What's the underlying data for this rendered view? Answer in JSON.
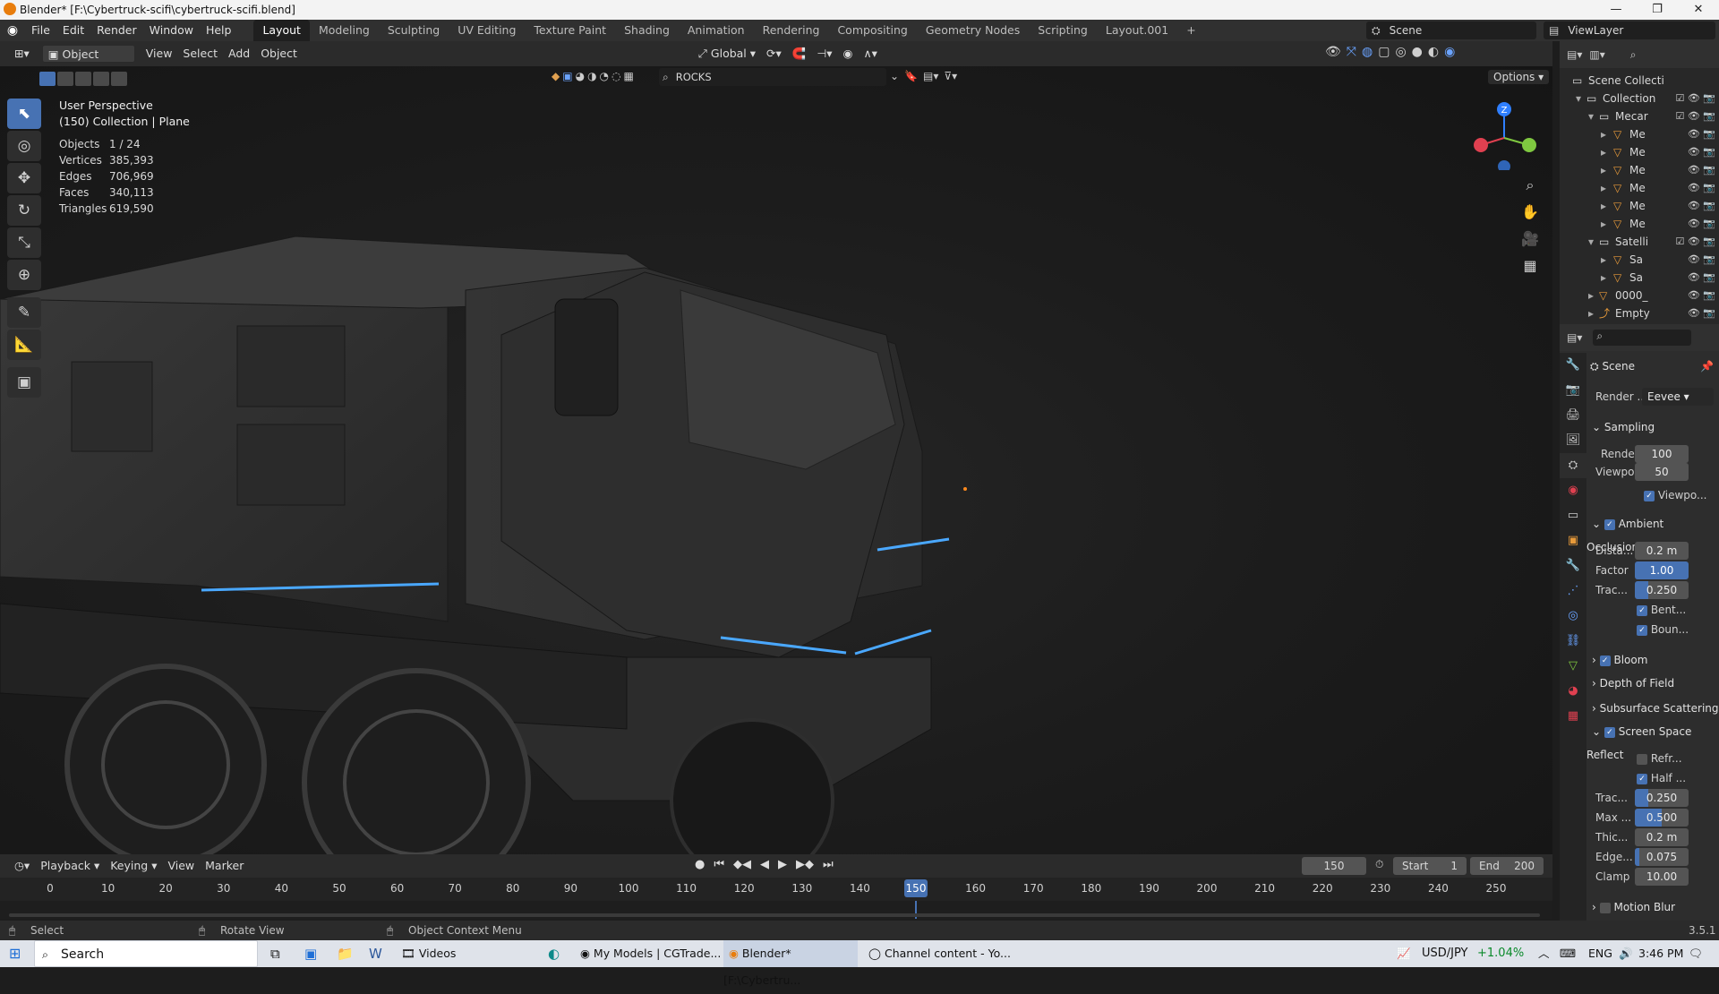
{
  "window": {
    "title": "Blender* [F:\\Cybertruck-scifi\\cybertruck-scifi.blend]",
    "buttons": [
      "—",
      "❐",
      "✕"
    ]
  },
  "menus": [
    "File",
    "Edit",
    "Render",
    "Window",
    "Help"
  ],
  "workspaces": [
    "Layout",
    "Modeling",
    "Sculpting",
    "UV Editing",
    "Texture Paint",
    "Shading",
    "Animation",
    "Rendering",
    "Compositing",
    "Geometry Nodes",
    "Scripting",
    "Layout.001",
    "+"
  ],
  "active_workspace": "Layout",
  "scene_selector": "Scene",
  "viewlayer_selector": "ViewLayer",
  "viewport_header": {
    "mode": "Object Mode",
    "menus": [
      "View",
      "Select",
      "Add",
      "Object"
    ],
    "transform_orientation": "Global",
    "search_value": "ROCKS",
    "options_label": "Options"
  },
  "viewport_overlay": {
    "view_name": "User Perspective",
    "collection_info": "(150) Collection | Plane",
    "stats": [
      {
        "label": "Objects",
        "value": "1 / 24"
      },
      {
        "label": "Vertices",
        "value": "385,393"
      },
      {
        "label": "Edges",
        "value": "706,969"
      },
      {
        "label": "Faces",
        "value": "340,113"
      },
      {
        "label": "Triangles",
        "value": "619,590"
      }
    ]
  },
  "gizmo": {
    "z_label": "Z"
  },
  "outliner": {
    "root": "Scene Collecti",
    "rows": [
      {
        "name": "Collection",
        "indent": 0,
        "icon": "collection"
      },
      {
        "name": "Mecar",
        "indent": 1,
        "icon": "collection"
      },
      {
        "name": "Me",
        "indent": 2,
        "icon": "mesh"
      },
      {
        "name": "Me",
        "indent": 2,
        "icon": "mesh"
      },
      {
        "name": "Me",
        "indent": 2,
        "icon": "mesh"
      },
      {
        "name": "Me",
        "indent": 2,
        "icon": "mesh"
      },
      {
        "name": "Me",
        "indent": 2,
        "icon": "mesh"
      },
      {
        "name": "Me",
        "indent": 2,
        "icon": "mesh"
      },
      {
        "name": "Satelli",
        "indent": 1,
        "icon": "collection"
      },
      {
        "name": "Sa",
        "indent": 2,
        "icon": "mesh"
      },
      {
        "name": "Sa",
        "indent": 2,
        "icon": "mesh"
      },
      {
        "name": "0000_",
        "indent": 1,
        "icon": "mesh"
      },
      {
        "name": "Empty",
        "indent": 1,
        "icon": "empty"
      }
    ]
  },
  "properties": {
    "context": "Scene",
    "render_engine_label": "Render ...",
    "render_engine_value": "Eevee",
    "sampling": {
      "title": "Sampling",
      "render_label": "Render",
      "render_value": "100",
      "viewport_label": "Viewport",
      "viewport_value": "50",
      "denoise_label": "Viewpo..."
    },
    "ao": {
      "title": "Ambient Occlusion",
      "distance_label": "Dista...",
      "distance_value": "0.2 m",
      "factor_label": "Factor",
      "factor_value": "1.00",
      "trace_label": "Trac...",
      "trace_value": "0.250",
      "bent_label": "Bent...",
      "bounce_label": "Boun..."
    },
    "bloom": "Bloom",
    "dof": "Depth of Field",
    "sss": "Subsurface Scattering",
    "ssr": {
      "title": "Screen Space Reflect",
      "refr_label": "Refr...",
      "half_label": "Half ...",
      "trace_label": "Trac...",
      "trace_value": "0.250",
      "max_label": "Max ...",
      "max_value": "0.500",
      "thick_label": "Thic...",
      "thick_value": "0.2 m",
      "edge_label": "Edge...",
      "edge_value": "0.075",
      "clamp_label": "Clamp",
      "clamp_value": "10.00"
    },
    "motion_blur": "Motion Blur"
  },
  "timeline": {
    "menus": [
      "Playback",
      "Keying",
      "View",
      "Marker"
    ],
    "current_frame": "150",
    "start_label": "Start",
    "start_value": "1",
    "end_label": "End",
    "end_value": "200",
    "ticks": [
      "0",
      "10",
      "20",
      "30",
      "40",
      "50",
      "60",
      "70",
      "80",
      "90",
      "100",
      "110",
      "120",
      "130",
      "140",
      "150",
      "160",
      "170",
      "180",
      "190",
      "200",
      "210",
      "220",
      "230",
      "240",
      "250"
    ]
  },
  "statusbar": {
    "select": "Select",
    "rotate": "Rotate View",
    "context_menu": "Object Context Menu",
    "version": "3.5.1"
  },
  "taskbar": {
    "search": "Search",
    "apps": [
      "Videos",
      "My Models | CGTrade...",
      "Blender* [F:\\Cybertru...",
      "Channel content - Yo..."
    ],
    "ticker": "USD/JPY",
    "ticker_change": "+1.04%",
    "lang": "ENG",
    "time": "3:46 PM"
  },
  "colors": {
    "accent": "#4772b3",
    "header_bg": "#303030",
    "viewport_bg": "#1c1c1c",
    "glow": "#4aa8ff",
    "frame_marker": "#4772b3"
  }
}
